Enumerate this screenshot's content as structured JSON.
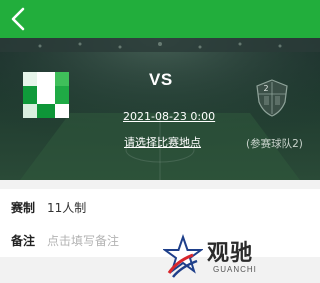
{
  "header": {
    "back_icon": "chevron-left-icon",
    "background_color": "#22ae3c"
  },
  "match": {
    "vs_text": "VS",
    "datetime": "2021-08-23 0:00",
    "venue_link": "请选择比赛地点",
    "team_right_name": "(参赛球队2)",
    "team_right_badge_number": "2"
  },
  "form": {
    "format_label": "赛制",
    "format_value": "11人制",
    "notes_label": "备注",
    "notes_placeholder": "点击填写备注"
  },
  "watermark": {
    "cn": "观驰",
    "en": "GUANCHI"
  }
}
